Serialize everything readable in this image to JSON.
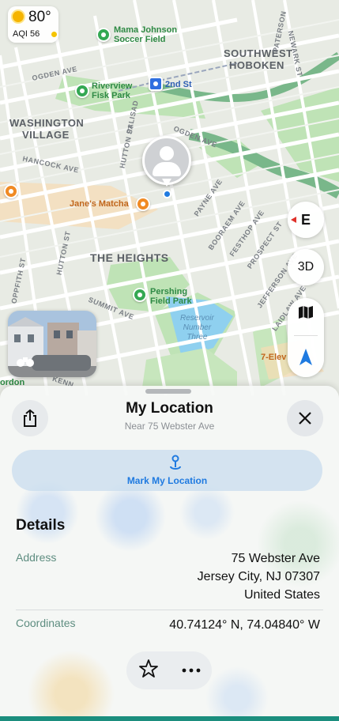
{
  "weather": {
    "temperature": "80°",
    "aqi": "AQI 56"
  },
  "map": {
    "areas": [
      "SOUTHWEST",
      "HOBOKEN",
      "WASHINGTON",
      "VILLAGE",
      "THE HEIGHTS"
    ],
    "pois": {
      "soccer_line1": "Mama Johnson",
      "soccer_line2": "Soccer Field",
      "riverview_line1": "Riverview",
      "riverview_line2": "Fisk Park",
      "station": "2nd St",
      "matcha": "Jane's Matcha",
      "pershing_line1": "Pershing",
      "pershing_line2": "Field Park",
      "reservoir_line1": "Reservoir",
      "reservoir_line2": "Number",
      "reservoir_line3": "Three",
      "seven_eleven": "7-Elev",
      "edge_left": "ordon"
    },
    "streets": {
      "ogden1": "OGDEN AVE",
      "ogden2": "OGDEN AVE",
      "hancock": "HANCOCK AVE",
      "hutton1": "HUTTON ST",
      "hutton2": "HUTTON ST",
      "palisade": "PALISAD",
      "paterson": "PATERSON",
      "newark": "NEWARK ST",
      "payne": "PAYNE AVE",
      "booraem": "BOORAEM AVE",
      "festhop": "FESTHOP AVE",
      "prospect": "PROSPECT ST",
      "jefferson": "JEFFERSON AVE",
      "laidlaw": "LAIDLAW AVE",
      "summit": "SUMMIT AVE",
      "oppfith": "OPPFITH ST",
      "kennedy": "KENN"
    }
  },
  "controls": {
    "compass": "E",
    "three_d": "3D"
  },
  "sheet": {
    "title": "My Location",
    "subtitle": "Near 75 Webster Ave",
    "mark_label": "Mark My Location",
    "details_heading": "Details",
    "address_label": "Address",
    "address_line1": "75 Webster Ave",
    "address_line2": "Jersey City, NJ  07307",
    "address_line3": "United States",
    "coordinates_label": "Coordinates",
    "coordinates_value": "40.74124° N, 74.04840° W"
  }
}
